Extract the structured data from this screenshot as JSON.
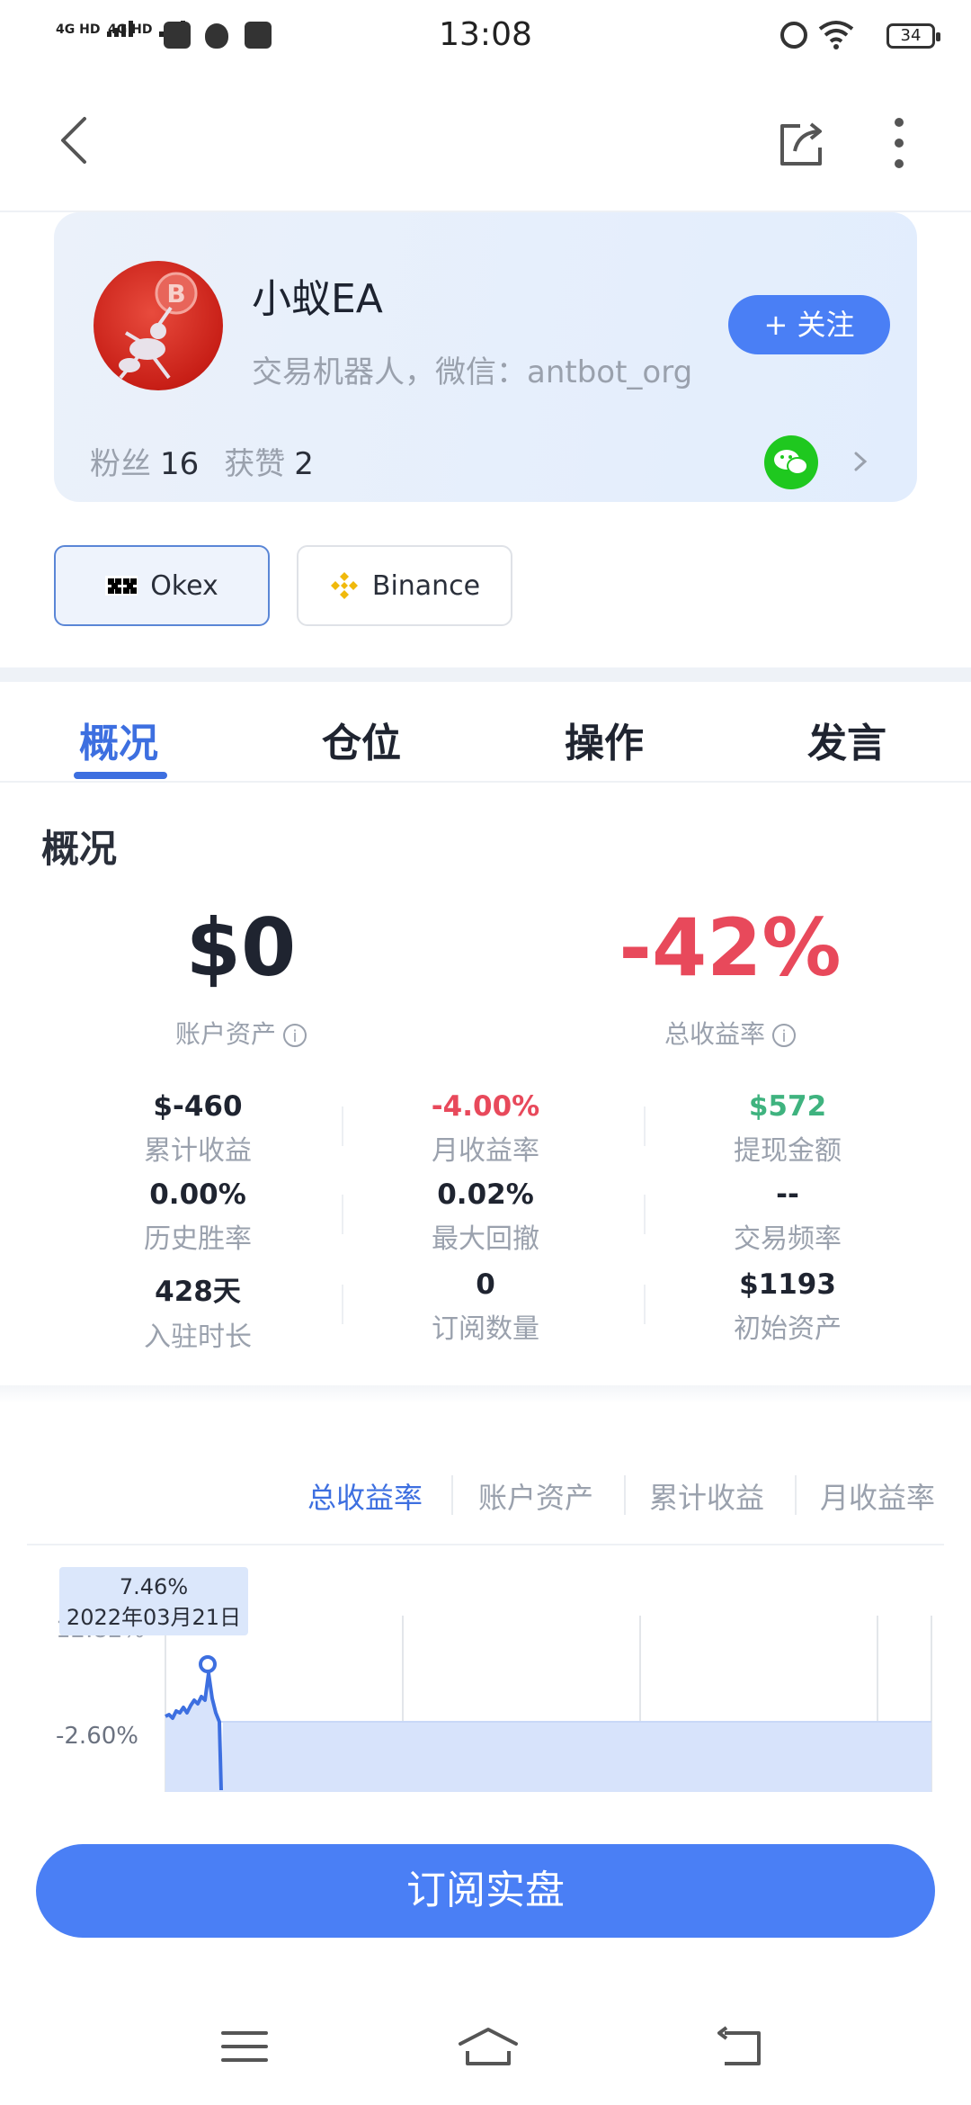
{
  "status_bar": {
    "time": "13:08",
    "signal1": "4G HD",
    "signal2": "4G HD",
    "battery": "34"
  },
  "profile": {
    "name": "小蚁EA",
    "description": "交易机器人，微信：antbot_org",
    "follow_label": "+ 关注",
    "fans_label": "粉丝",
    "fans_count": "16",
    "likes_label": "获赞",
    "likes_count": "2"
  },
  "exchanges": [
    {
      "name": "Okex",
      "selected": true
    },
    {
      "name": "Binance",
      "selected": false
    }
  ],
  "tabs": [
    {
      "label": "概况",
      "active": true
    },
    {
      "label": "仓位",
      "active": false
    },
    {
      "label": "操作",
      "active": false
    },
    {
      "label": "发言",
      "active": false
    }
  ],
  "overview": {
    "title": "概况",
    "account_assets_value": "$0",
    "account_assets_label": "账户资产",
    "total_return_value": "-42%",
    "total_return_label": "总收益率",
    "metrics": [
      {
        "value": "$-460",
        "label": "累计收益",
        "color": "#1f2430"
      },
      {
        "value": "-4.00%",
        "label": "月收益率",
        "color": "#e8495b"
      },
      {
        "value": "$572",
        "label": "提现金额",
        "color": "#3fb37f"
      },
      {
        "value": "0.00%",
        "label": "历史胜率",
        "color": "#1f2430"
      },
      {
        "value": "0.02%",
        "label": "最大回撤",
        "color": "#1f2430"
      },
      {
        "value": "--",
        "label": "交易频率",
        "color": "#1f2430"
      },
      {
        "value": "428天",
        "label": "入驻时长",
        "color": "#1f2430"
      },
      {
        "value": "0",
        "label": "订阅数量",
        "color": "#1f2430"
      },
      {
        "value": "$1193",
        "label": "初始资产",
        "color": "#1f2430"
      }
    ]
  },
  "chart_tabs": [
    {
      "label": "总收益率",
      "active": true
    },
    {
      "label": "账户资产",
      "active": false
    },
    {
      "label": "累计收益",
      "active": false
    },
    {
      "label": "月收益率",
      "active": false
    }
  ],
  "chart": {
    "tooltip_value": "7.46%",
    "tooltip_date": "2022年03月21日",
    "y_tick_top": "12.82%",
    "y_tick_bottom": "-2.60%"
  },
  "subscribe_label": "订阅实盘",
  "colors": {
    "accent": "#4a7ff5",
    "negative": "#e8495b",
    "positive": "#3fb37f"
  }
}
